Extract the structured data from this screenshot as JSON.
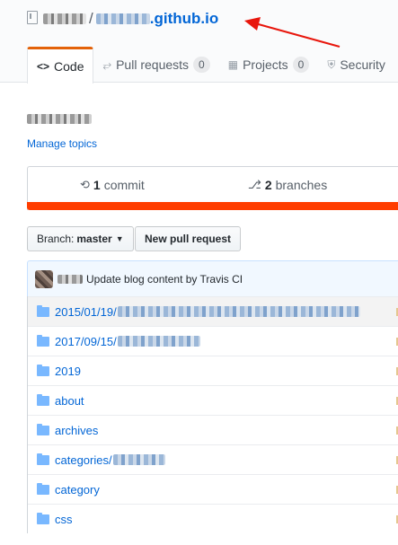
{
  "header": {
    "repo_suffix": ".github.io",
    "separator": "/"
  },
  "tabs": [
    {
      "label": "Code",
      "icon": "code-icon"
    },
    {
      "label": "Pull requests",
      "count": "0",
      "icon": "pull-request-icon"
    },
    {
      "label": "Projects",
      "count": "0",
      "icon": "project-icon"
    },
    {
      "label": "Security",
      "icon": "shield-icon"
    }
  ],
  "manage_topics": "Manage topics",
  "summary": {
    "commits_count": "1",
    "commits_label": "commit",
    "branches_count": "2",
    "branches_label": "branches",
    "language_color": "#ff3d00"
  },
  "branch_button": {
    "label": "Branch:",
    "value": "master"
  },
  "new_pr_button": "New pull request",
  "latest_commit": {
    "message": "Update blog content by Travis CI"
  },
  "files": [
    {
      "name": "2015/01/19/",
      "type": "dir"
    },
    {
      "name": "2017/09/15/",
      "type": "dir"
    },
    {
      "name": "2019",
      "type": "dir"
    },
    {
      "name": "about",
      "type": "dir"
    },
    {
      "name": "archives",
      "type": "dir"
    },
    {
      "name": "categories/",
      "type": "dir"
    },
    {
      "name": "category",
      "type": "dir"
    },
    {
      "name": "css",
      "type": "dir"
    }
  ],
  "annotation": {
    "arrow_color": "#e8160c"
  }
}
